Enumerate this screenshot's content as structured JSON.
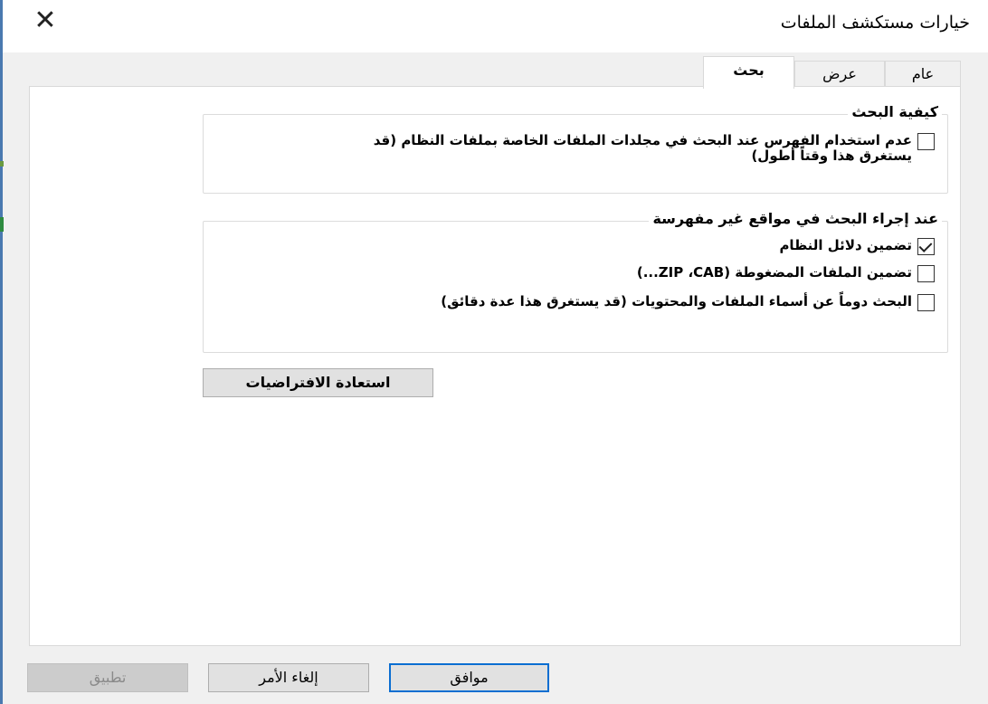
{
  "window": {
    "title": "خيارات مستكشف الملفات",
    "close_icon": "close-icon"
  },
  "tabs": [
    {
      "label": "عام",
      "active": false
    },
    {
      "label": "عرض",
      "active": false
    },
    {
      "label": "بحث",
      "active": true
    }
  ],
  "search_panel": {
    "how_to_search": {
      "title": "كيفية البحث",
      "options": [
        {
          "label": "عدم استخدام الفهرس عند البحث في مجلدات الملفات الخاصة بملفات النظام (قد يستغرق هذا وقتاً أطول)",
          "checked": false
        }
      ]
    },
    "non_indexed": {
      "title": "عند إجراء البحث في مواقع غير مفهرسة",
      "options": [
        {
          "label": "تضمين دلائل النظام",
          "checked": true
        },
        {
          "label": "تضمين الملفات المضغوطة (ZIP ،CAB...)",
          "checked": false
        },
        {
          "label": "البحث دوماً عن أسماء الملفات والمحتويات (قد يستغرق هذا عدة دقائق)",
          "checked": false
        }
      ]
    },
    "restore_defaults_label": "استعادة الافتراضيات"
  },
  "footer": {
    "ok_label": "موافق",
    "cancel_label": "إلغاء الأمر",
    "apply_label": "تطبيق"
  },
  "colors": {
    "accent_border": "#0a6ed1",
    "window_edge": "#4a79b0"
  }
}
